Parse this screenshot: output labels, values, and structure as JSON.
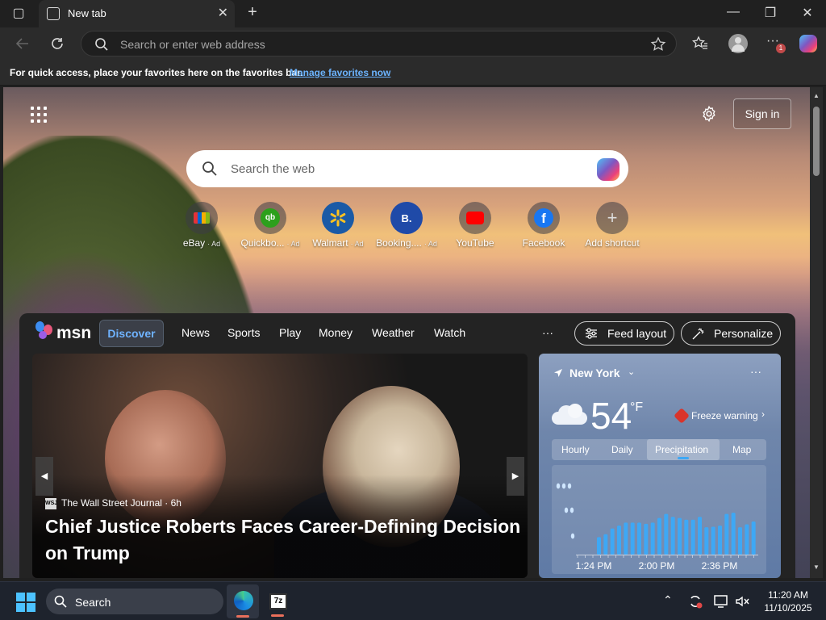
{
  "browser": {
    "tab_title": "New tab",
    "address_placeholder": "Search or enter web address",
    "profile_badge": "1"
  },
  "favorites_bar": {
    "message": "For quick access, place your favorites here on the favorites bar.",
    "link": "Manage favorites now"
  },
  "newtab": {
    "sign_in": "Sign in",
    "search_placeholder": "Search the web",
    "shortcuts": [
      {
        "label": "eBay",
        "ad": "· Ad"
      },
      {
        "label": "Quickbo...",
        "ad": "· Ad"
      },
      {
        "label": "Walmart",
        "ad": "· Ad"
      },
      {
        "label": "Booking....",
        "ad": "· Ad"
      },
      {
        "label": "YouTube",
        "ad": ""
      },
      {
        "label": "Facebook",
        "ad": ""
      },
      {
        "label": "Add shortcut",
        "ad": ""
      }
    ],
    "shortcut_glyphs": [
      "",
      "qb",
      "",
      "B.",
      "",
      "f",
      "+"
    ]
  },
  "msn": {
    "logo": "msn",
    "tabs": [
      "Discover",
      "News",
      "Sports",
      "Play",
      "Money",
      "Weather",
      "Watch"
    ],
    "more": "···",
    "feed_layout": "Feed layout",
    "personalize": "Personalize"
  },
  "hero": {
    "source": "The Wall Street Journal",
    "source_logo": "WSJ",
    "age": "· 6h",
    "headline": "Chief Justice Roberts Faces Career-Defining Decision on Trump"
  },
  "weather": {
    "city": "New York",
    "temp": "54",
    "unit": "°F",
    "warning": "Freeze warning",
    "tabs": [
      "Hourly",
      "Daily",
      "Precipitation",
      "Map"
    ],
    "active_tab": "Precipitation",
    "more": "···"
  },
  "chart_data": {
    "type": "bar",
    "x_tick_labels": [
      "1:24 PM",
      "2:00 PM",
      "2:36 PM"
    ],
    "values": [
      0.3,
      0.35,
      0.45,
      0.5,
      0.55,
      0.55,
      0.55,
      0.53,
      0.55,
      0.63,
      0.7,
      0.65,
      0.63,
      0.6,
      0.6,
      0.65,
      0.47,
      0.48,
      0.5,
      0.7,
      0.72,
      0.47,
      0.52,
      0.57
    ],
    "ylim": [
      0,
      1
    ],
    "color": "#3ea8f5"
  },
  "taskbar": {
    "search": "Search",
    "time": "11:20 AM",
    "date": "11/10/2025"
  }
}
